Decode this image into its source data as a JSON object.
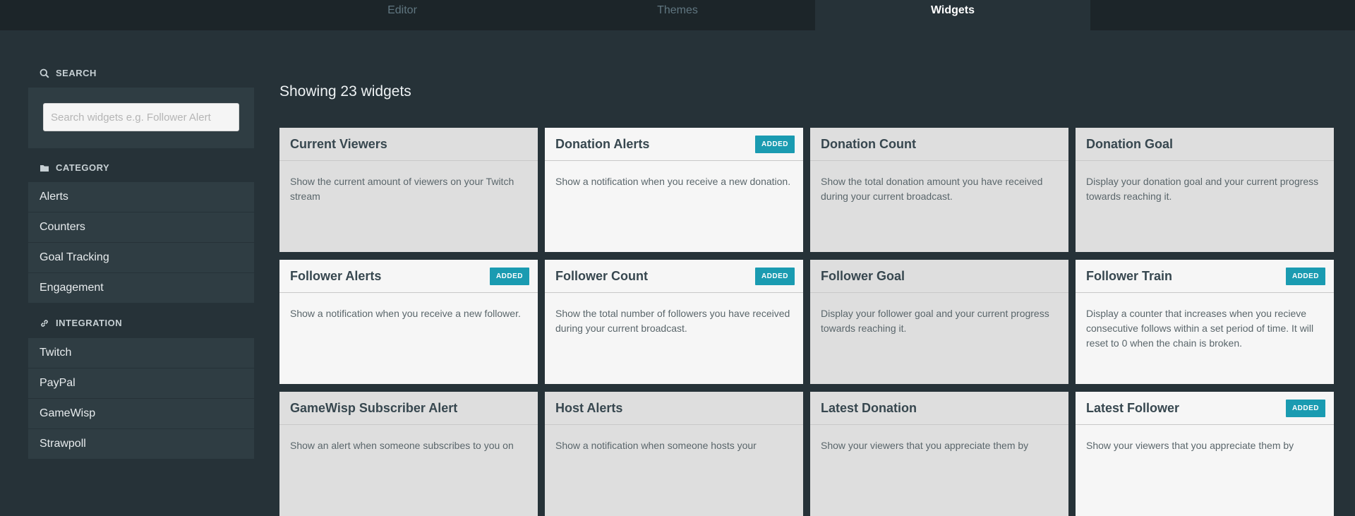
{
  "tabs": [
    {
      "label": "Editor"
    },
    {
      "label": "Themes"
    },
    {
      "label": "Widgets"
    }
  ],
  "sidebar": {
    "search_heading": "SEARCH",
    "search_placeholder": "Search widgets e.g. Follower Alert",
    "search_value": "",
    "category_heading": "CATEGORY",
    "categories": [
      "Alerts",
      "Counters",
      "Goal Tracking",
      "Engagement"
    ],
    "integration_heading": "INTEGRATION",
    "integrations": [
      "Twitch",
      "PayPal",
      "GameWisp",
      "Strawpoll"
    ]
  },
  "main": {
    "showing": "Showing 23 widgets",
    "added_badge": "ADDED",
    "widgets": [
      {
        "title": "Current Viewers",
        "desc": "Show the current amount of viewers on your Twitch stream",
        "added": false
      },
      {
        "title": "Donation Alerts",
        "desc": "Show a notification when you receive a new donation.",
        "added": true
      },
      {
        "title": "Donation Count",
        "desc": "Show the total donation amount you have received during your current broadcast.",
        "added": false
      },
      {
        "title": "Donation Goal",
        "desc": "Display your donation goal and your current progress towards reaching it.",
        "added": false
      },
      {
        "title": "Follower Alerts",
        "desc": "Show a notification when you receive a new follower.",
        "added": true
      },
      {
        "title": "Follower Count",
        "desc": "Show the total number of followers you have received during your current broadcast.",
        "added": true
      },
      {
        "title": "Follower Goal",
        "desc": "Display your follower goal and your current progress towards reaching it.",
        "added": false
      },
      {
        "title": "Follower Train",
        "desc": "Display a counter that increases when you recieve consecutive follows within a set period of time. It will reset to 0 when the chain is broken.",
        "added": true
      },
      {
        "title": "GameWisp Subscriber Alert",
        "desc": "Show an alert when someone subscribes to you on",
        "added": false
      },
      {
        "title": "Host Alerts",
        "desc": "Show a notification when someone hosts your",
        "added": false
      },
      {
        "title": "Latest Donation",
        "desc": "Show your viewers that you appreciate them by",
        "added": false
      },
      {
        "title": "Latest Follower",
        "desc": "Show your viewers that you appreciate them by",
        "added": true
      }
    ]
  },
  "colors": {
    "background": "#263238",
    "topbar": "#1c2529",
    "sidebar_item": "#2f3d43",
    "card_default": "#dedede",
    "card_added": "#f6f6f6",
    "badge": "#1a9bb1"
  },
  "icons": {
    "search": "search-icon",
    "category": "folder-icon",
    "integration": "link-icon"
  }
}
